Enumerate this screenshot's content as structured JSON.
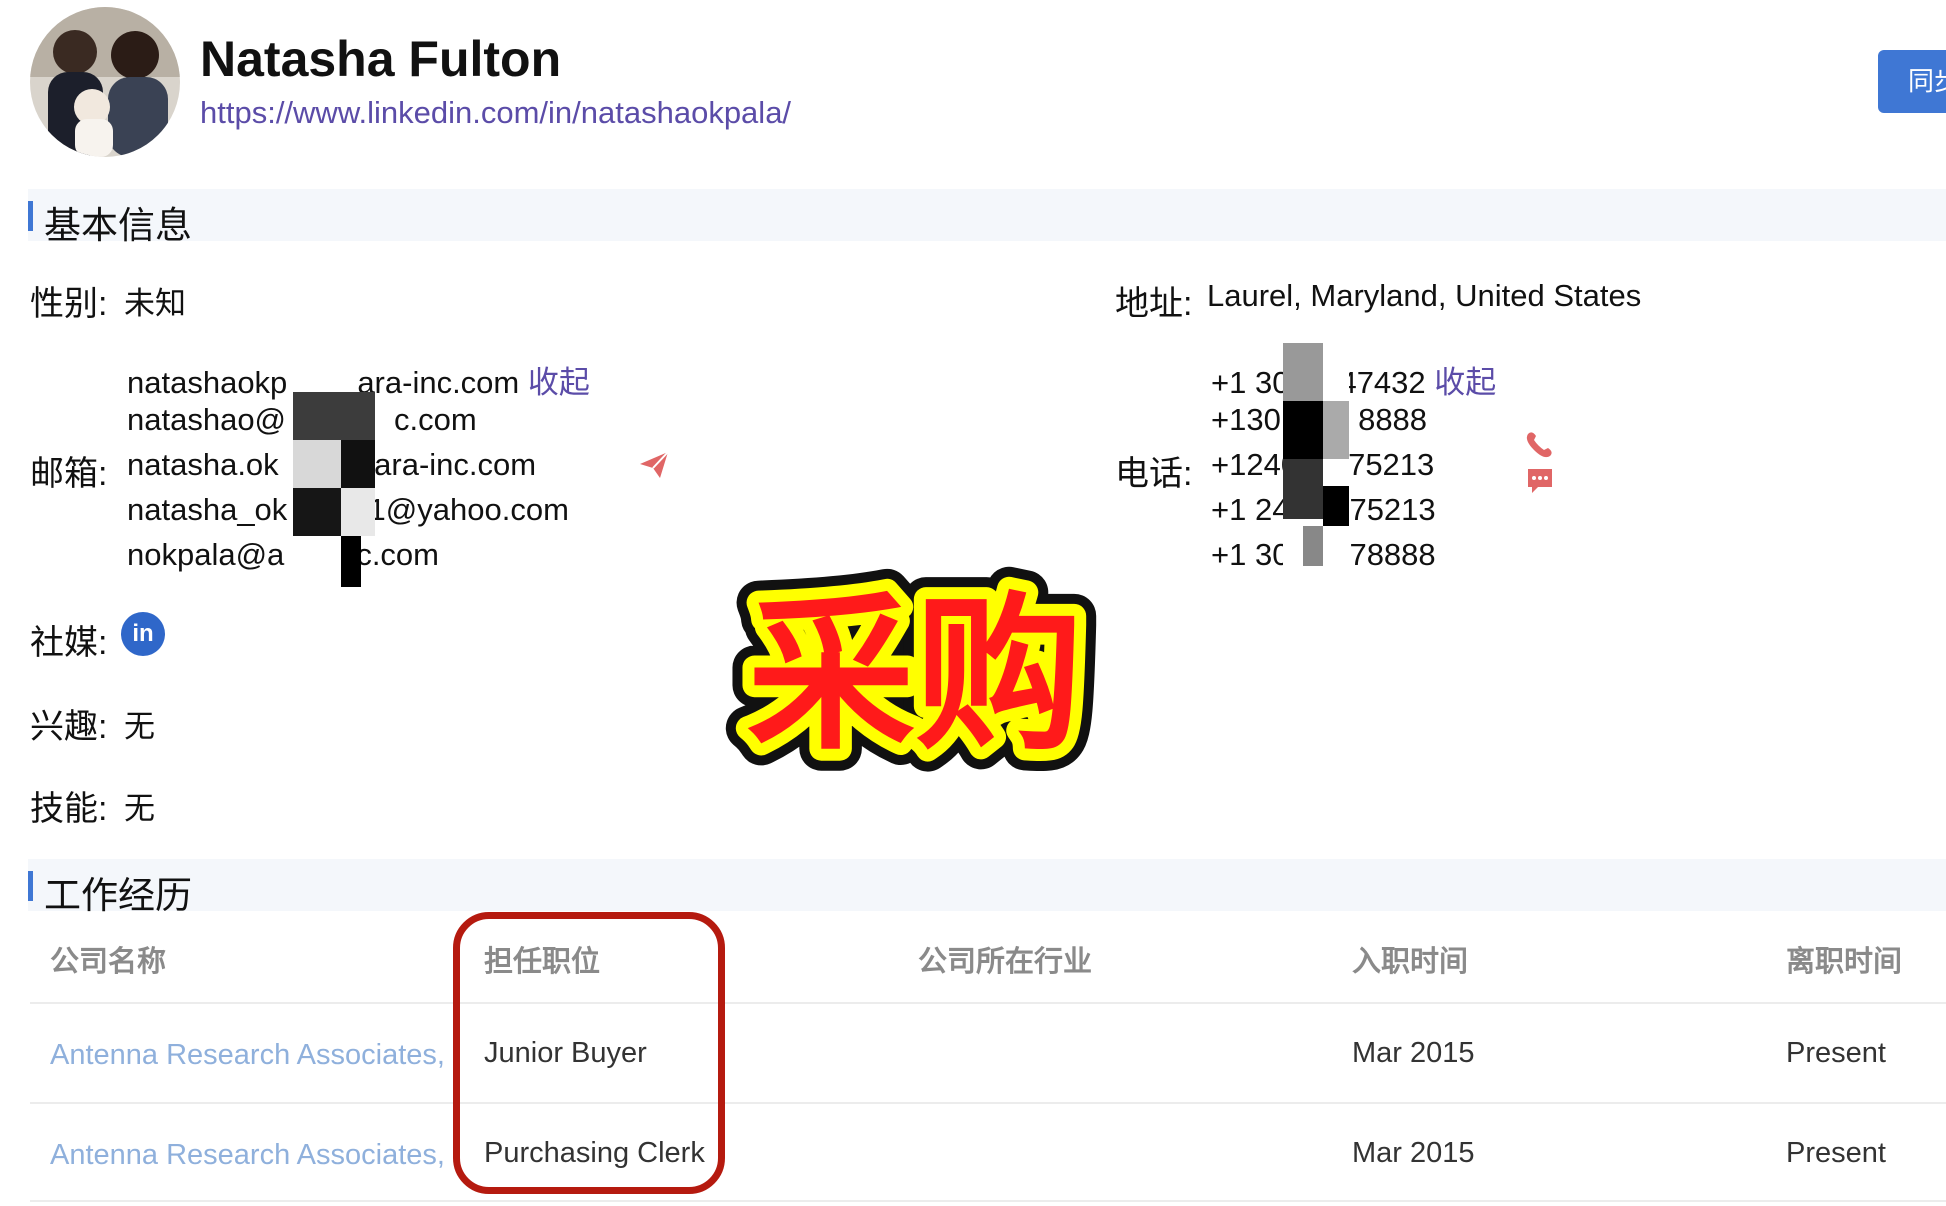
{
  "profile": {
    "name": "Natasha Fulton",
    "url": "https://www.linkedin.com/in/natashaokpala/",
    "sync_button": "同步"
  },
  "basic": {
    "title": "基本信息",
    "gender_label": "性别:",
    "gender_value": "未知",
    "address_label": "地址:",
    "address_value": "Laurel, Maryland, United States",
    "email_label": "邮箱:",
    "emails": [
      "natashaokp",
      "ara-inc.com",
      "natashao@",
      "c.com",
      "natasha.ok",
      "@ara-inc.com",
      "natasha_ok",
      "21@yahoo.com",
      "nokpala@a",
      "c.com"
    ],
    "email_collapse": "收起",
    "phone_label": "电话:",
    "phones": [
      "+1 30",
      "47432",
      "+1301",
      "8888",
      "+1240",
      "75213",
      "+1 24",
      "75213",
      "+1 30",
      "78888"
    ],
    "phone_collapse": "收起",
    "social_label": "社媒:",
    "social_icon": "linkedin-icon",
    "social_icon_text": "in",
    "interests_label": "兴趣:",
    "interests_value": "无",
    "skills_label": "技能:",
    "skills_value": "无"
  },
  "overlay": {
    "text": "采购"
  },
  "work": {
    "title": "工作经历",
    "columns": [
      "公司名称",
      "担任职位",
      "公司所在行业",
      "入职时间",
      "离职时间"
    ],
    "rows": [
      {
        "company": "Antenna Research Associates,",
        "position": "Junior Buyer",
        "industry": "",
        "start": "Mar 2015",
        "end": "Present"
      },
      {
        "company": "Antenna Research Associates,",
        "position": "Purchasing Clerk",
        "industry": "",
        "start": "Mar 2015",
        "end": "Present"
      }
    ]
  },
  "colors": {
    "accent": "#3f77d4",
    "link": "#5b4ca8",
    "icon_red": "#e06666",
    "highlight_circle": "#b51a0f",
    "sticker_red": "#ff1a1a",
    "sticker_yellow": "#ffff00"
  }
}
